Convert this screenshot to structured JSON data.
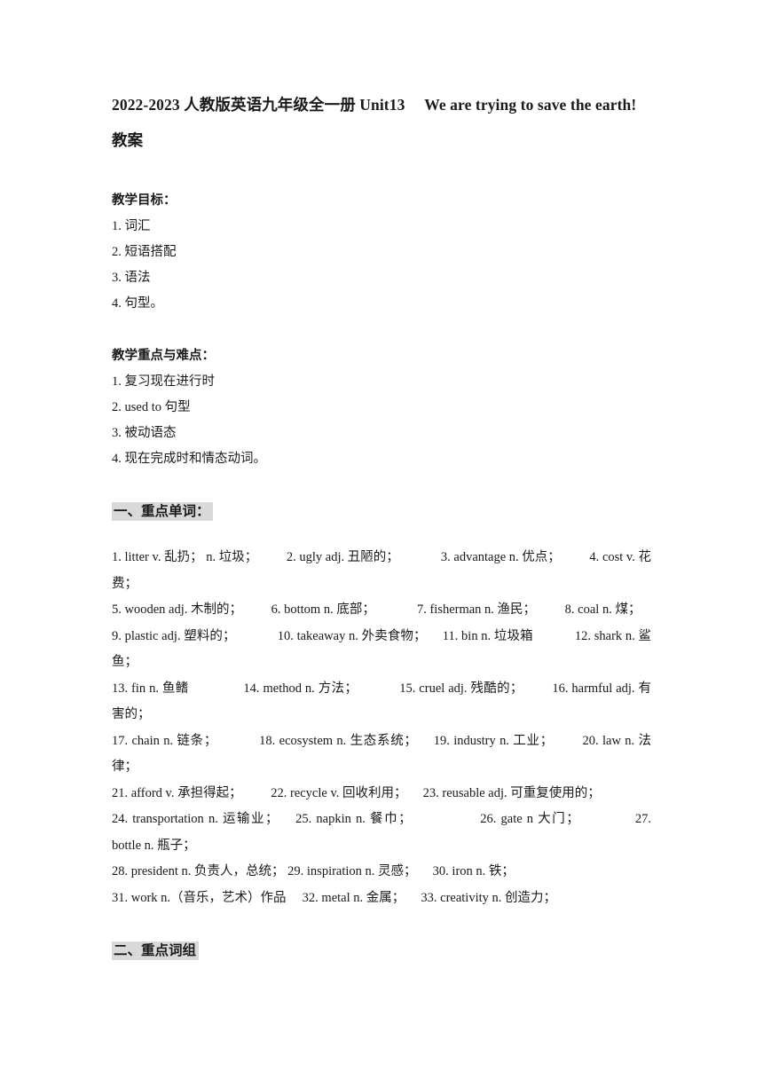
{
  "document": {
    "title": "2022-2023 人教版英语九年级全一册 Unit13  We are trying to save the earth!教案",
    "objectives": {
      "heading": "教学目标：",
      "items": [
        "1. 词汇",
        "2. 短语搭配",
        "3. 语法",
        "4. 句型。"
      ]
    },
    "key_points": {
      "heading": "教学重点与难点：",
      "items": [
        "1. 复习现在进行时",
        "2. used to 句型",
        "3. 被动语态",
        "4. 现在完成时和情态动词。"
      ]
    },
    "section_one": {
      "heading": "一、重点单词：",
      "lines": [
        "1. litter v. 乱扔； n. 垃圾；   2. ugly adj. 丑陋的；    3. advantage n. 优点；   4. cost v. 花费；",
        "5. wooden adj. 木制的；   6. bottom n. 底部；    7. fisherman n. 渔民；   8. coal n. 煤；",
        "9. plastic adj. 塑料的；    10. takeaway n. 外卖食物；  11. bin n. 垃圾箱    12. shark n. 鲨鱼；",
        "13. fin n. 鱼鳍     14. method n. 方法；    15. cruel adj. 残酷的；   16. harmful adj. 有害的；",
        "17. chain n. 链条；    18. ecosystem n. 生态系统；  19. industry n. 工业；   20. law n. 法律；",
        "21. afford v. 承担得起；   22. recycle v. 回收利用；  23. reusable adj. 可重复使用的；",
        "24. transportation n. 运输业；  25. napkin n. 餐巾；      26. gate n 大门；     27. bottle n. 瓶子；",
        "28. president n. 负责人，总统； 29. inspiration n. 灵感；  30. iron n. 铁；",
        "31. work n.（音乐，艺术）作品  32. metal n. 金属；  33. creativity n. 创造力；"
      ]
    },
    "section_two": {
      "heading": "二、重点词组"
    }
  },
  "colors": {
    "highlight": "#d9d9d9",
    "text": "#1a1a1a",
    "page_background": "#ffffff"
  }
}
